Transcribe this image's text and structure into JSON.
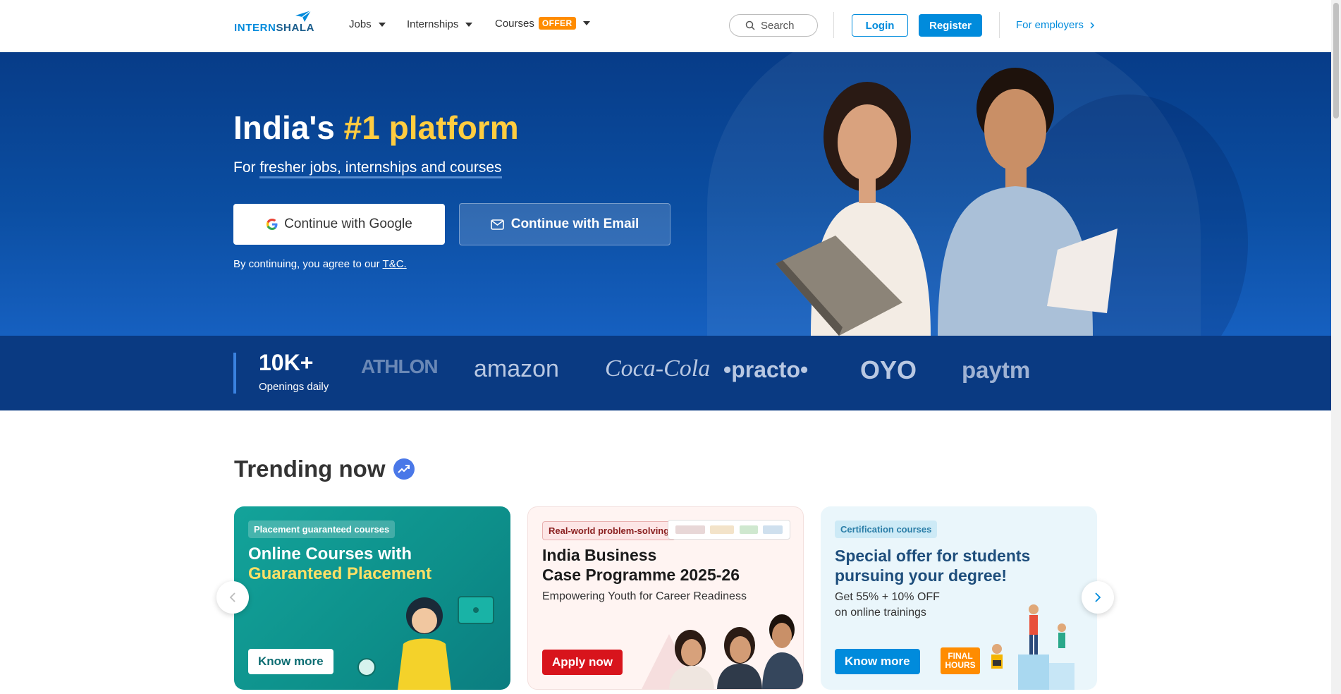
{
  "header": {
    "logo": {
      "part1": "INTERN",
      "part2": "SHALA"
    },
    "nav": [
      {
        "label": "Jobs"
      },
      {
        "label": "Internships"
      },
      {
        "label": "Courses",
        "badge": "OFFER"
      }
    ],
    "search_label": "Search",
    "login_label": "Login",
    "register_label": "Register",
    "employers_label": "For employers"
  },
  "hero": {
    "title_prefix": "India's ",
    "title_accent": "#1 platform",
    "subtitle_prefix": "For ",
    "subtitle_underlined": "fresher jobs, internships and courses",
    "google_button": "Continue with Google",
    "email_button": "Continue with Email",
    "terms_prefix": "By continuing, you agree to our ",
    "terms_link": "T&C."
  },
  "stats": {
    "number": "10K+",
    "label": "Openings daily",
    "brands": [
      "ATHLON",
      "amazon",
      "Coca-Cola",
      "•practo•",
      "OYO",
      "paytm"
    ]
  },
  "trending": {
    "title": "Trending now",
    "cards": [
      {
        "tag": "Placement guaranteed courses",
        "title_line1": "Online Courses with",
        "title_line2": "Guaranteed Placement",
        "button": "Know more"
      },
      {
        "tag": "Real-world problem-solving",
        "title_line1": "India Business",
        "title_line2": "Case Programme 2025-26",
        "desc": "Empowering Youth for Career Readiness",
        "button": "Apply now"
      },
      {
        "tag": "Certification courses",
        "title_line1": "Special offer for students",
        "title_line2": "pursuing your degree!",
        "desc_line1": "Get 55% + 10% OFF",
        "desc_line2": "on online trainings",
        "badge": "FINAL HOURS",
        "button": "Know more"
      }
    ]
  },
  "colors": {
    "brand_blue": "#008bdc",
    "hero_blue": "#0b4ea2",
    "accent_yellow": "#ffcc40",
    "offer_orange": "#ff8c00",
    "apply_red": "#d8141c"
  }
}
